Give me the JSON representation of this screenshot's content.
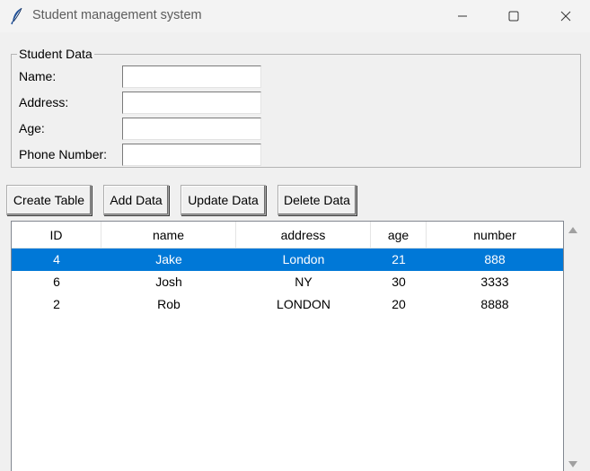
{
  "window": {
    "title": "Student management system",
    "icon": "feather-icon"
  },
  "form": {
    "legend": "Student Data",
    "fields": [
      {
        "label": "Name:",
        "value": ""
      },
      {
        "label": "Address:",
        "value": ""
      },
      {
        "label": "Age:",
        "value": ""
      },
      {
        "label": "Phone Number:",
        "value": ""
      }
    ]
  },
  "buttons": {
    "create_table": "Create Table",
    "add_data": "Add Data",
    "update_data": "Update Data",
    "delete_data": "Delete Data"
  },
  "table": {
    "columns": [
      "ID",
      "name",
      "address",
      "age",
      "number"
    ],
    "rows": [
      {
        "cells": [
          "4",
          "Jake",
          "London",
          "21",
          "888"
        ],
        "selected": true
      },
      {
        "cells": [
          "6",
          "Josh",
          "NY",
          "30",
          "3333"
        ],
        "selected": false
      },
      {
        "cells": [
          "2",
          "Rob",
          "LONDON",
          "20",
          "8888"
        ],
        "selected": false
      }
    ]
  },
  "colors": {
    "selection": "#0078d7",
    "window_bg": "#f0f0f0"
  }
}
